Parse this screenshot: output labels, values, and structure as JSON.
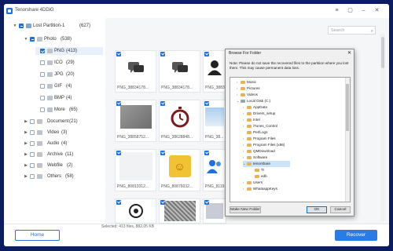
{
  "app": {
    "title": "Tenorshare 4DDiG"
  },
  "sidebar": {
    "items": [
      {
        "label": "Lost Partition-1",
        "count": "(627)"
      },
      {
        "label": "Photo",
        "count": "(538)"
      },
      {
        "label": "PNG",
        "count": "(413)"
      },
      {
        "label": "ICO",
        "count": "(29)"
      },
      {
        "label": "JPG",
        "count": "(20)"
      },
      {
        "label": "GIF",
        "count": "(4)"
      },
      {
        "label": "BMP",
        "count": "(4)"
      },
      {
        "label": "More",
        "count": "(65)"
      },
      {
        "label": "Document",
        "count": "(21)"
      },
      {
        "label": "Video",
        "count": "(3)"
      },
      {
        "label": "Audio",
        "count": "(4)"
      },
      {
        "label": "Archive",
        "count": "(11)"
      },
      {
        "label": "Webfile",
        "count": "(2)"
      },
      {
        "label": "Others",
        "count": "(58)"
      }
    ]
  },
  "search": {
    "placeholder": "Search"
  },
  "thumbnails": [
    {
      "name": "PNG_38834178..."
    },
    {
      "name": "PNG_38834178..."
    },
    {
      "name": "PNG_38834..."
    },
    {
      "name": "PNG_38858752..."
    },
    {
      "name": "PNG_38628848..."
    },
    {
      "name": "PNG_38..."
    },
    {
      "name": "PNG_80813312..."
    },
    {
      "name": "PNG_80876032..."
    },
    {
      "name": "PNG_8119..."
    },
    {
      "name": "",
      "partial": true
    },
    {
      "name": "",
      "partial": true
    },
    {
      "name": "",
      "partial": true
    }
  ],
  "status": {
    "text": "Selected: 413 files, 882.05 KB"
  },
  "buttons": {
    "home": "Home",
    "recover": "Recover"
  },
  "dialog": {
    "title": "Browse For Folder",
    "note": "Note: Please do not save the recovered files to the partition where you lost them. This may cause permanent data loss.",
    "tree": [
      "Music",
      "Pictures",
      "Videos",
      "Local Disk (C:)",
      "AppData",
      "Drivers_setup",
      "Intel",
      "iTunes_Control",
      "PerfLogs",
      "Program Files",
      "Program Files (x86)",
      "QMDownload",
      "Software",
      "tenorshare",
      "Tr",
      "edb",
      "Users",
      "WhatsappKeys"
    ],
    "make_new_folder": "Make New Folder",
    "ok": "OK",
    "cancel": "Cancel"
  },
  "colors": {
    "accent": "#2a7be4",
    "frame": "#0b1c63",
    "folder": "#e8b44c"
  }
}
